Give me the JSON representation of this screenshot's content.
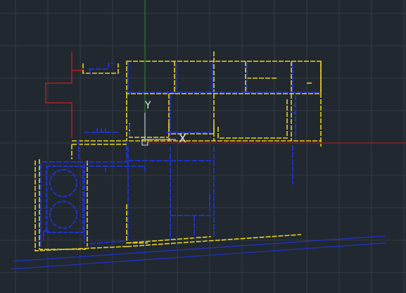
{
  "canvas": {
    "background_color": "#212830",
    "grid_minor_color": "#2a313b",
    "grid_major_color": "#323a45"
  },
  "axes": {
    "x_axis_color": "#b81c1c",
    "y_axis_color": "#2f8a2f"
  },
  "ucs_icon": {
    "x_label": "X",
    "y_label": "Y",
    "color": "#e8e8e8"
  },
  "layers": {
    "walls_yellow": "#e6d21e",
    "walls_blue": "#2233cc",
    "annex_red": "#cc2020",
    "road_blue": "#2233cc"
  }
}
